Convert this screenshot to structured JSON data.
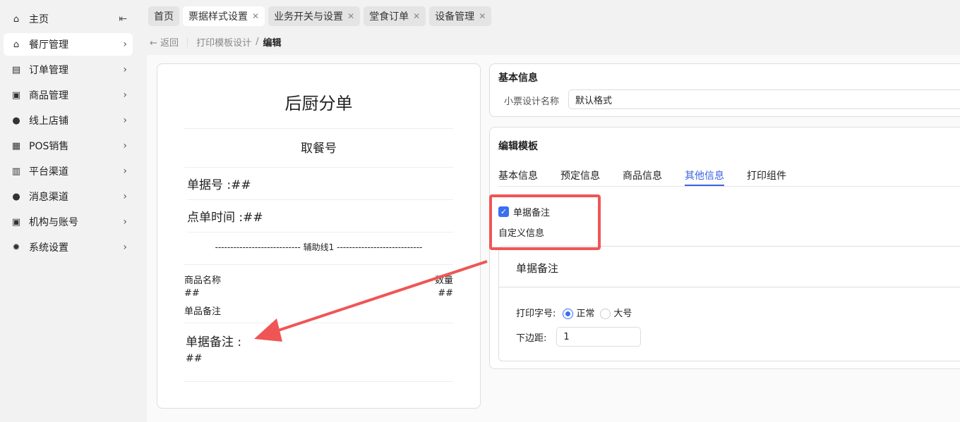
{
  "sidebar": {
    "items": [
      {
        "label": "主页",
        "icon": "home-icon"
      },
      {
        "label": "餐厅管理",
        "icon": "store-icon"
      },
      {
        "label": "订单管理",
        "icon": "order-icon"
      },
      {
        "label": "商品管理",
        "icon": "product-icon"
      },
      {
        "label": "线上店铺",
        "icon": "globe-icon"
      },
      {
        "label": "POS销售",
        "icon": "cart-icon"
      },
      {
        "label": "平台渠道",
        "icon": "bank-icon"
      },
      {
        "label": "消息渠道",
        "icon": "message-icon"
      },
      {
        "label": "机构与账号",
        "icon": "account-icon"
      },
      {
        "label": "系统设置",
        "icon": "gear-icon"
      }
    ]
  },
  "tabs": [
    "首页",
    "票据样式设置",
    "业务开关与设置",
    "堂食订单",
    "设备管理"
  ],
  "breadcrumb": {
    "back": "返回",
    "parent": "打印模板设计",
    "current": "编辑"
  },
  "preview": {
    "title": "后厨分单",
    "pickup": "取餐号",
    "bill_no": "单据号 :##",
    "order_time": "点单时间 :##",
    "aux_line": "---------------------------- 辅助线1 ----------------------------",
    "col_name": "商品名称",
    "col_qty": "数量",
    "name_val": "##",
    "qty_val": "##",
    "item_note": "单品备注",
    "bill_note": "单据备注 :",
    "bill_note_val": "##"
  },
  "basic": {
    "title": "基本信息",
    "name_label": "小票设计名称",
    "name_value": "默认格式"
  },
  "edit": {
    "title": "编辑模板",
    "tabs": [
      "基本信息",
      "预定信息",
      "商品信息",
      "其他信息",
      "打印组件"
    ],
    "checkbox_label": "单据备注",
    "custom_info": "自定义信息",
    "sub_title": "单据备注",
    "font_label": "打印字号:",
    "font_normal": "正常",
    "font_large": "大号",
    "margin_label": "下边距:",
    "margin_value": "1"
  },
  "colors": {
    "accent": "#3a6ff0",
    "annotation": "#f05555"
  }
}
